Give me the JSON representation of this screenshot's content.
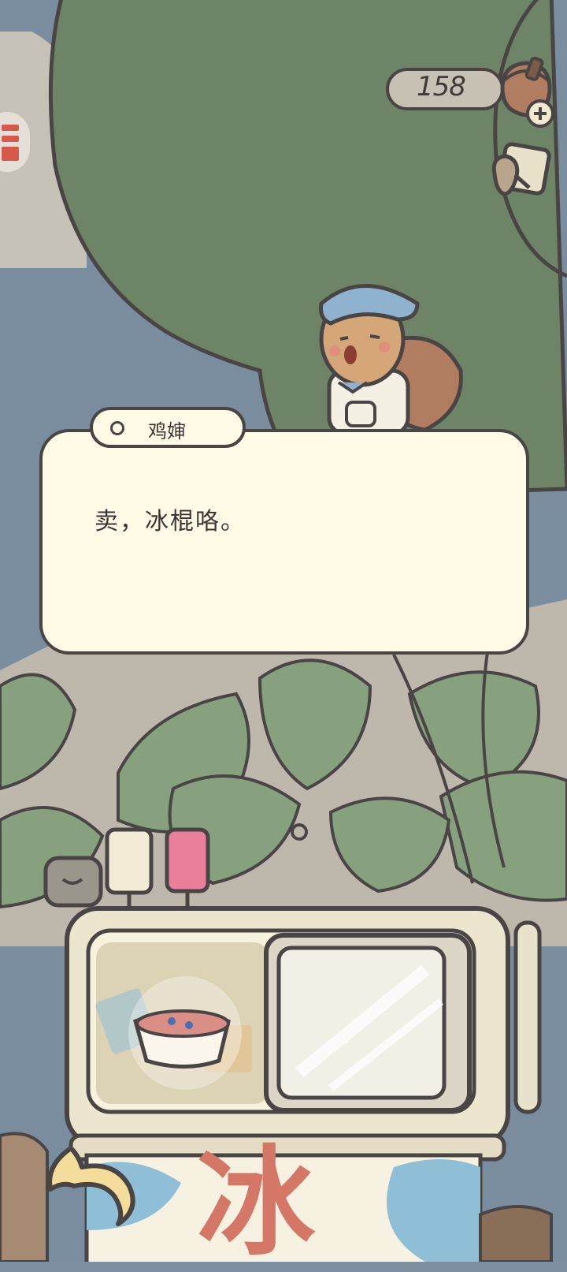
{
  "hud": {
    "currency_value": "158",
    "currency_icon": "acorn-icon",
    "add_icon": "plus-icon",
    "tool_icon": "feedback-icon",
    "side_tab_icon": "menu-tab-icon"
  },
  "dialog": {
    "speaker": "鸡婶",
    "text": "卖，冰棍咯。"
  },
  "cart": {
    "sign_char": "冰",
    "back_icon": "back-arrow-icon"
  }
}
